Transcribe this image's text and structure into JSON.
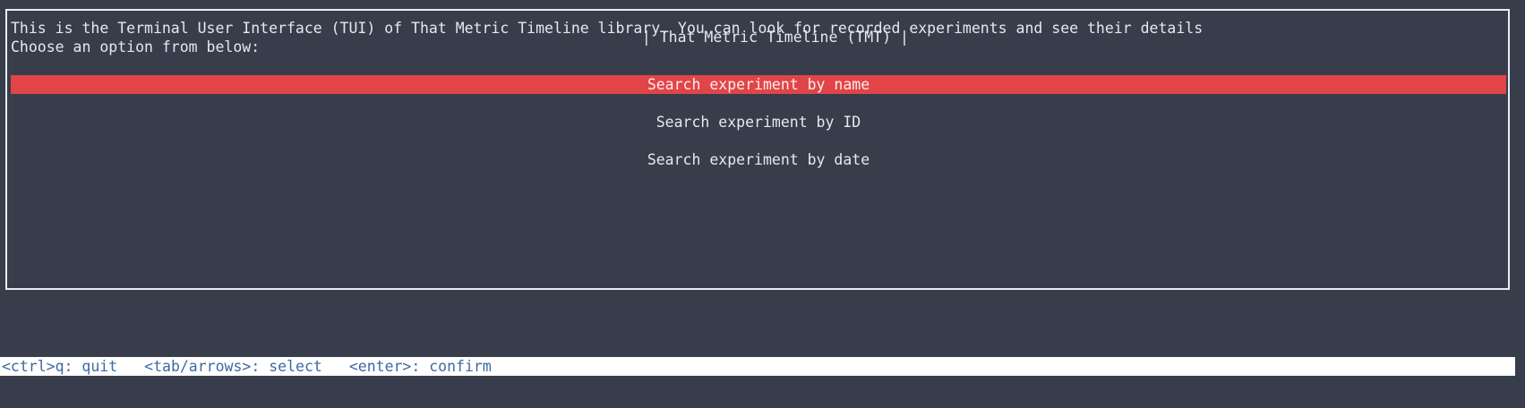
{
  "window": {
    "title": "That Metric Timeline (TMT)"
  },
  "intro": {
    "description": "This is the Terminal User Interface (TUI) of That Metric Timeline library. You can look for recorded experiments and see their details",
    "prompt": "Choose an option from below:"
  },
  "menu": {
    "options": [
      {
        "label": "Search experiment by name",
        "selected": true
      },
      {
        "label": "Search experiment by ID",
        "selected": false
      },
      {
        "label": "Search experiment by date",
        "selected": false
      }
    ]
  },
  "statusbar": {
    "hints": [
      "<ctrl>q: quit",
      "<tab/arrows>: select",
      "<enter>: confirm"
    ]
  },
  "colors": {
    "background": "#373d4b",
    "selected": "#e14548",
    "statusbar_bg": "#ffffff",
    "statusbar_text": "#3c6aa1"
  }
}
